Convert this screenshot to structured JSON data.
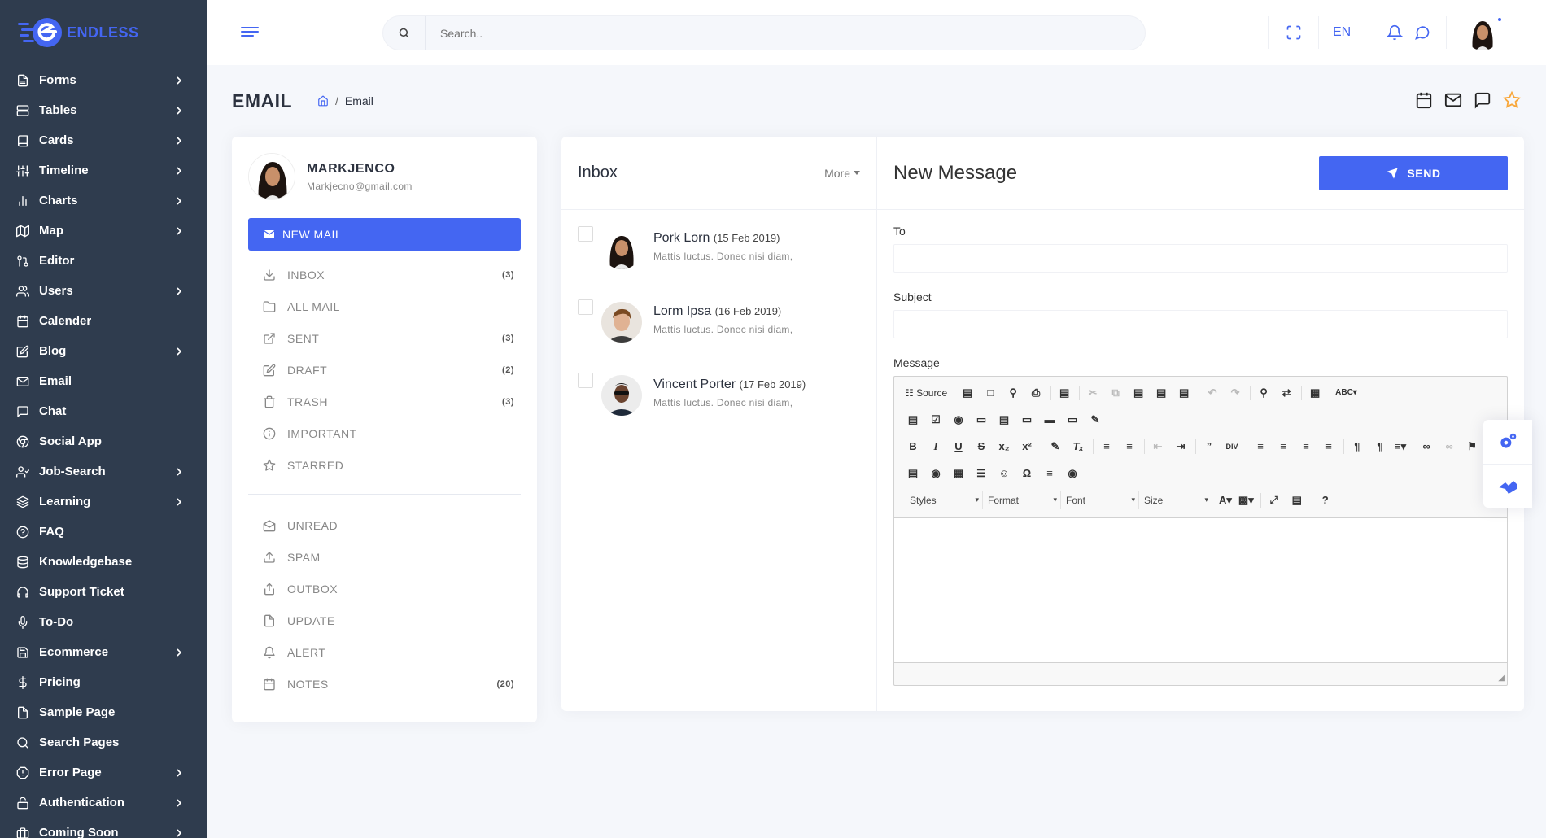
{
  "app": {
    "name": "ENDLESS"
  },
  "sidebar": {
    "items": [
      {
        "label": "Forms",
        "icon": "file-text-icon",
        "has_chevron": true
      },
      {
        "label": "Tables",
        "icon": "server-icon",
        "has_chevron": true
      },
      {
        "label": "Cards",
        "icon": "book-icon",
        "has_chevron": true
      },
      {
        "label": "Timeline",
        "icon": "sliders-icon",
        "has_chevron": true
      },
      {
        "label": "Charts",
        "icon": "bar-chart-icon",
        "has_chevron": true
      },
      {
        "label": "Map",
        "icon": "map-icon",
        "has_chevron": true
      },
      {
        "label": "Editor",
        "icon": "git-pull-request-icon",
        "has_chevron": false
      },
      {
        "label": "Users",
        "icon": "users-icon",
        "has_chevron": true
      },
      {
        "label": "Calender",
        "icon": "calendar-icon",
        "has_chevron": false
      },
      {
        "label": "Blog",
        "icon": "edit-icon",
        "has_chevron": true
      },
      {
        "label": "Email",
        "icon": "mail-icon",
        "has_chevron": false
      },
      {
        "label": "Chat",
        "icon": "message-square-icon",
        "has_chevron": false
      },
      {
        "label": "Social App",
        "icon": "chrome-icon",
        "has_chevron": false
      },
      {
        "label": "Job-Search",
        "icon": "user-check-icon",
        "has_chevron": true
      },
      {
        "label": "Learning",
        "icon": "layers-icon",
        "has_chevron": true
      },
      {
        "label": "FAQ",
        "icon": "help-circle-icon",
        "has_chevron": false
      },
      {
        "label": "Knowledgebase",
        "icon": "database-icon",
        "has_chevron": false
      },
      {
        "label": "Support Ticket",
        "icon": "headphones-icon",
        "has_chevron": false
      },
      {
        "label": "To-Do",
        "icon": "mic-icon",
        "has_chevron": false
      },
      {
        "label": "Ecommerce",
        "icon": "save-icon",
        "has_chevron": true
      },
      {
        "label": "Pricing",
        "icon": "dollar-sign-icon",
        "has_chevron": false
      },
      {
        "label": "Sample Page",
        "icon": "file-icon",
        "has_chevron": false
      },
      {
        "label": "Search Pages",
        "icon": "search-icon",
        "has_chevron": false
      },
      {
        "label": "Error Page",
        "icon": "alert-octagon-icon",
        "has_chevron": true
      },
      {
        "label": "Authentication",
        "icon": "unlock-icon",
        "has_chevron": true
      },
      {
        "label": "Coming Soon",
        "icon": "briefcase-icon",
        "has_chevron": true
      }
    ]
  },
  "topbar": {
    "search_placeholder": "Search..",
    "language": "EN"
  },
  "page": {
    "title": "EMAIL",
    "breadcrumb_current": "Email"
  },
  "profile": {
    "name": "MARKJENCO",
    "email": "Markjecno@gmail.com"
  },
  "new_mail_label": "NEW MAIL",
  "folders_primary": [
    {
      "label": "INBOX",
      "count": "(3)",
      "icon": "download-icon"
    },
    {
      "label": "ALL MAIL",
      "count": "",
      "icon": "folder-icon"
    },
    {
      "label": "SENT",
      "count": "(3)",
      "icon": "external-link-icon"
    },
    {
      "label": "DRAFT",
      "count": "(2)",
      "icon": "edit-icon"
    },
    {
      "label": "TRASH",
      "count": "(3)",
      "icon": "trash-icon"
    },
    {
      "label": "IMPORTANT",
      "count": "",
      "icon": "info-icon"
    },
    {
      "label": "STARRED",
      "count": "",
      "icon": "star-icon"
    }
  ],
  "folders_secondary": [
    {
      "label": "UNREAD",
      "count": "",
      "icon": "envelope-open-icon"
    },
    {
      "label": "SPAM",
      "count": "",
      "icon": "upload-icon"
    },
    {
      "label": "OUTBOX",
      "count": "",
      "icon": "share-icon"
    },
    {
      "label": "UPDATE",
      "count": "",
      "icon": "file-icon"
    },
    {
      "label": "ALERT",
      "count": "",
      "icon": "bell-icon"
    },
    {
      "label": "NOTES",
      "count": "(20)",
      "icon": "calendar-icon"
    }
  ],
  "inbox": {
    "title": "Inbox",
    "more_label": "More",
    "mails": [
      {
        "sender": "Pork Lorn",
        "date": "(15 Feb 2019)",
        "snippet": "Mattis luctus. Donec nisi diam,"
      },
      {
        "sender": "Lorm Ipsa",
        "date": "(16 Feb 2019)",
        "snippet": "Mattis luctus. Donec nisi diam,"
      },
      {
        "sender": "Vincent Porter",
        "date": "(17 Feb 2019)",
        "snippet": "Mattis luctus. Donec nisi diam,"
      }
    ]
  },
  "compose": {
    "title": "New Message",
    "send_label": "SEND",
    "to_label": "To",
    "subject_label": "Subject",
    "message_label": "Message",
    "to_value": "",
    "subject_value": ""
  },
  "editor": {
    "source_label": "Source",
    "combos": [
      "Styles",
      "Format",
      "Font",
      "Size"
    ]
  },
  "colors": {
    "accent": "#4466f2",
    "sidebar_bg": "#2f3c4e",
    "page_bg": "#f5f7fb",
    "star": "#f8a73a"
  }
}
